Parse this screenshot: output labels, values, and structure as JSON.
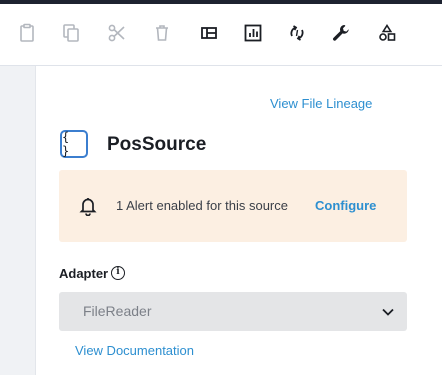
{
  "toolbar": {
    "tools": [
      {
        "icon": "clipboard-icon",
        "enabled": false
      },
      {
        "icon": "copy-icon",
        "enabled": false
      },
      {
        "icon": "scissors-icon",
        "enabled": false
      },
      {
        "icon": "trash-icon",
        "enabled": false
      },
      {
        "icon": "layout-icon",
        "enabled": true
      },
      {
        "icon": "chart-icon",
        "enabled": true
      },
      {
        "icon": "sync-icon",
        "enabled": true
      },
      {
        "icon": "wrench-icon",
        "enabled": true
      },
      {
        "icon": "shapes-icon",
        "enabled": true
      }
    ],
    "colors": {
      "enabled": "#1b1e24",
      "disabled": "#b3b7be"
    }
  },
  "panel": {
    "lineage_link": "View File Lineage",
    "source_icon_glyph": "{ }",
    "source_name": "PosSource",
    "alert": {
      "text": "1 Alert enabled for this source",
      "configure_label": "Configure"
    },
    "adapter": {
      "label": "Adapter",
      "info_glyph": "i",
      "selected": "FileReader"
    },
    "documentation_link": "View Documentation"
  },
  "colors": {
    "link": "#2d8fd0",
    "alert_bg": "#fcefe2",
    "select_bg": "#e4e5e7",
    "source_icon_border": "#3b7ecf"
  }
}
